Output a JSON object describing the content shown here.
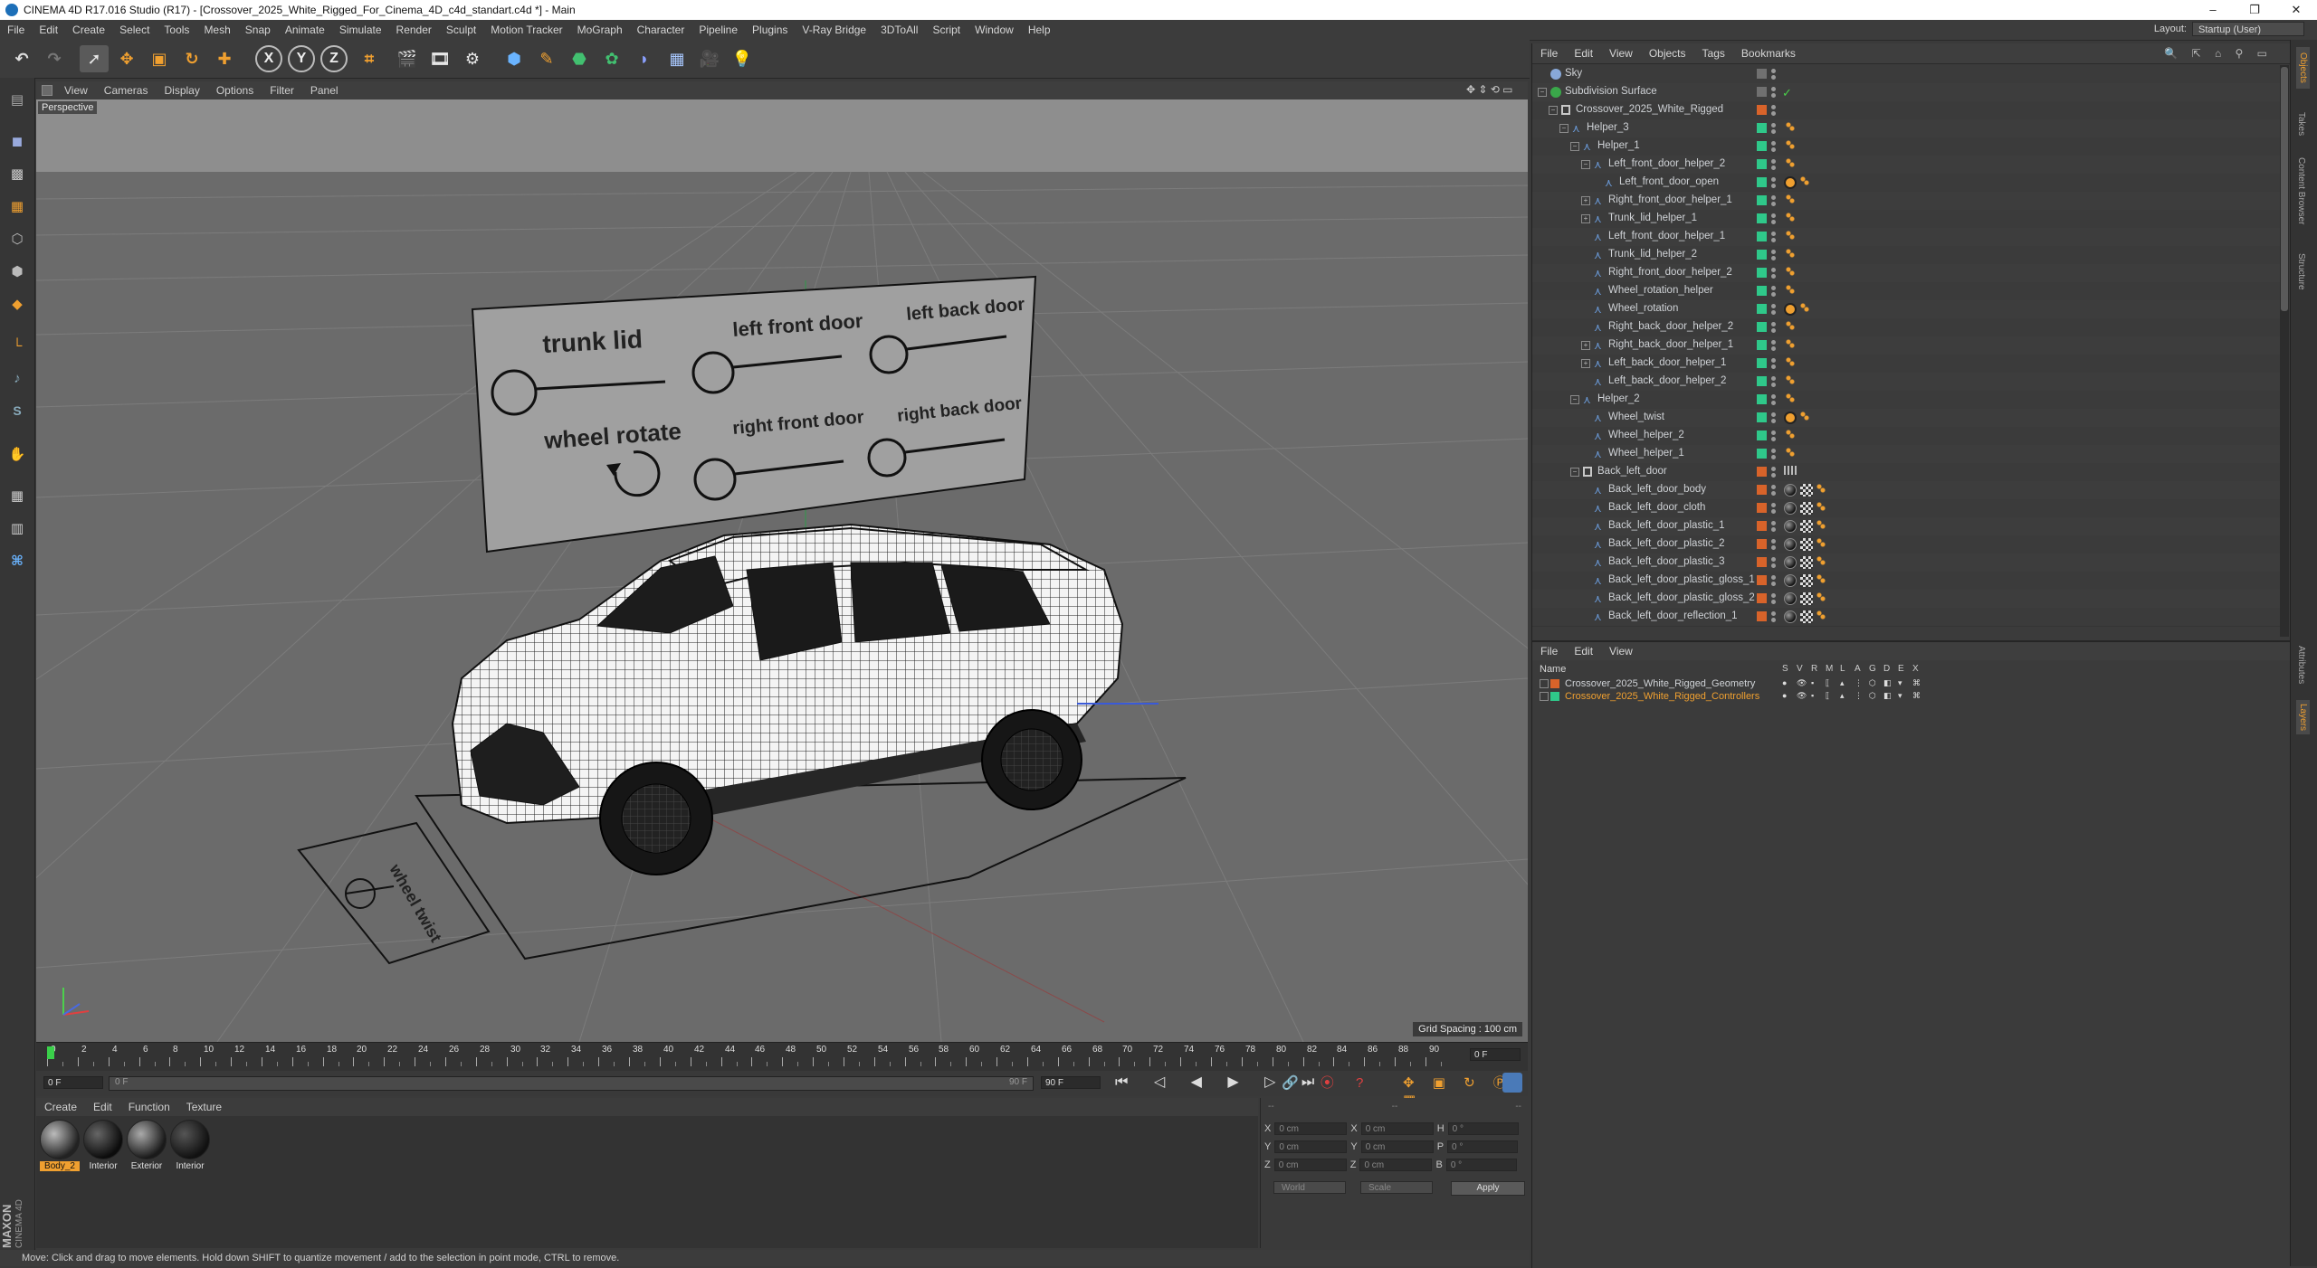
{
  "window": {
    "title": "CINEMA 4D R17.016 Studio (R17) - [Crossover_2025_White_Rigged_For_Cinema_4D_c4d_standart.c4d *] - Main",
    "min": "–",
    "max": "❐",
    "close": "✕"
  },
  "menubar": [
    "File",
    "Edit",
    "Create",
    "Select",
    "Tools",
    "Mesh",
    "Snap",
    "Animate",
    "Simulate",
    "Render",
    "Sculpt",
    "Motion Tracker",
    "MoGraph",
    "Character",
    "Pipeline",
    "Plugins",
    "V-Ray Bridge",
    "3DToAll",
    "Script",
    "Window",
    "Help"
  ],
  "layout": {
    "label": "Layout:",
    "value": "Startup (User)"
  },
  "toolbar_icons": [
    "undo-icon",
    "redo-icon",
    "live-selection-icon",
    "move-icon",
    "scale-icon",
    "rotate-icon",
    "add-icon",
    "x-axis-icon",
    "y-axis-icon",
    "z-axis-icon",
    "coordinate-system-icon",
    "render-view-icon",
    "render-picture-viewer-icon",
    "edit-render-settings-icon",
    "cube-icon",
    "pen-icon",
    "subdivision-icon",
    "cloner-icon",
    "deformer-icon",
    "floor-icon",
    "camera-icon",
    "light-icon"
  ],
  "toolbar_axis": {
    "x": "X",
    "y": "Y",
    "z": "Z"
  },
  "left_tool_labels": {
    "s": "S"
  },
  "viewport": {
    "menu": [
      "View",
      "Cameras",
      "Display",
      "Options",
      "Filter",
      "Panel"
    ],
    "projection": "Perspective",
    "grid_spacing": "Grid Spacing : 100 cm",
    "board_labels": [
      "trunk lid",
      "left front door",
      "left back door",
      "wheel rotate",
      "right front door",
      "right back door"
    ],
    "small_board_label": "wheel twist"
  },
  "timeline": {
    "ticks": [
      "0",
      "2",
      "4",
      "6",
      "8",
      "10",
      "12",
      "14",
      "16",
      "18",
      "20",
      "22",
      "24",
      "26",
      "28",
      "30",
      "32",
      "34",
      "36",
      "38",
      "40",
      "42",
      "44",
      "46",
      "48",
      "50",
      "52",
      "54",
      "56",
      "58",
      "60",
      "62",
      "64",
      "66",
      "68",
      "70",
      "72",
      "74",
      "76",
      "78",
      "80",
      "82",
      "84",
      "86",
      "88",
      "90"
    ],
    "current_frame": "0 F",
    "start_field": "0 F",
    "end_field": "90 F",
    "slider_left": "0 F",
    "slider_right": "90 F"
  },
  "materials": {
    "menu": [
      "Create",
      "Edit",
      "Function",
      "Texture"
    ],
    "items": [
      {
        "name": "Body_2",
        "selected": true
      },
      {
        "name": "Interior",
        "selected": false
      },
      {
        "name": "Exterior",
        "selected": false
      },
      {
        "name": "Interior",
        "selected": false
      }
    ]
  },
  "coords": {
    "header_dashes": [
      "--",
      "--",
      "--"
    ],
    "rows": [
      {
        "a": "X",
        "av": "0 cm",
        "b": "X",
        "bv": "0 cm",
        "c": "H",
        "cv": "0 °"
      },
      {
        "a": "Y",
        "av": "0 cm",
        "b": "Y",
        "bv": "0 cm",
        "c": "P",
        "cv": "0 °"
      },
      {
        "a": "Z",
        "av": "0 cm",
        "b": "Z",
        "bv": "0 cm",
        "c": "B",
        "cv": "0 °"
      }
    ],
    "mode1": "World",
    "mode2": "Scale",
    "apply": "Apply"
  },
  "status": "Move: Click and drag to move elements. Hold down SHIFT to quantize movement / add to the selection in point mode, CTRL to remove.",
  "maxon": {
    "brand": "MAXON",
    "product": "CINEMA 4D"
  },
  "objects": {
    "menu": [
      "File",
      "Edit",
      "View",
      "Objects",
      "Tags",
      "Bookmarks"
    ],
    "rows": [
      {
        "name": "Sky",
        "indent": 0,
        "icon": "sky",
        "color": "#707070",
        "tags": "none",
        "exp": ""
      },
      {
        "name": "Subdivision Surface",
        "indent": 0,
        "icon": "subdiv",
        "color": "#707070",
        "tags": "check",
        "exp": "-"
      },
      {
        "name": "Crossover_2025_White_Rigged",
        "indent": 1,
        "icon": "null",
        "color": "#d8632a",
        "tags": "none",
        "exp": "-"
      },
      {
        "name": "Helper_3",
        "indent": 2,
        "icon": "joint",
        "color": "#2fc88a",
        "tags": "dot",
        "exp": "-"
      },
      {
        "name": "Helper_1",
        "indent": 3,
        "icon": "joint",
        "color": "#2fc88a",
        "tags": "dot",
        "exp": "-"
      },
      {
        "name": "Left_front_door_helper_2",
        "indent": 4,
        "icon": "joint",
        "color": "#2fc88a",
        "tags": "dot",
        "exp": "-"
      },
      {
        "name": "Left_front_door_open",
        "indent": 5,
        "icon": "joint",
        "color": "#2fc88a",
        "tags": "xp",
        "exp": ""
      },
      {
        "name": "Right_front_door_helper_1",
        "indent": 4,
        "icon": "joint",
        "color": "#2fc88a",
        "tags": "dot",
        "exp": "+"
      },
      {
        "name": "Trunk_lid_helper_1",
        "indent": 4,
        "icon": "joint",
        "color": "#2fc88a",
        "tags": "dot",
        "exp": "+"
      },
      {
        "name": "Left_front_door_helper_1",
        "indent": 4,
        "icon": "joint",
        "color": "#2fc88a",
        "tags": "dot",
        "exp": ""
      },
      {
        "name": "Trunk_lid_helper_2",
        "indent": 4,
        "icon": "joint",
        "color": "#2fc88a",
        "tags": "dot",
        "exp": ""
      },
      {
        "name": "Right_front_door_helper_2",
        "indent": 4,
        "icon": "joint",
        "color": "#2fc88a",
        "tags": "dot",
        "exp": ""
      },
      {
        "name": "Wheel_rotation_helper",
        "indent": 4,
        "icon": "joint",
        "color": "#2fc88a",
        "tags": "dot",
        "exp": ""
      },
      {
        "name": "Wheel_rotation",
        "indent": 4,
        "icon": "joint",
        "color": "#2fc88a",
        "tags": "xp",
        "exp": ""
      },
      {
        "name": "Right_back_door_helper_2",
        "indent": 4,
        "icon": "joint",
        "color": "#2fc88a",
        "tags": "dot",
        "exp": ""
      },
      {
        "name": "Right_back_door_helper_1",
        "indent": 4,
        "icon": "joint",
        "color": "#2fc88a",
        "tags": "dot",
        "exp": "+"
      },
      {
        "name": "Left_back_door_helper_1",
        "indent": 4,
        "icon": "joint",
        "color": "#2fc88a",
        "tags": "dot",
        "exp": "+"
      },
      {
        "name": "Left_back_door_helper_2",
        "indent": 4,
        "icon": "joint",
        "color": "#2fc88a",
        "tags": "dot",
        "exp": ""
      },
      {
        "name": "Helper_2",
        "indent": 3,
        "icon": "joint",
        "color": "#2fc88a",
        "tags": "dot",
        "exp": "-"
      },
      {
        "name": "Wheel_twist",
        "indent": 4,
        "icon": "joint",
        "color": "#2fc88a",
        "tags": "xp",
        "exp": ""
      },
      {
        "name": "Wheel_helper_2",
        "indent": 4,
        "icon": "joint",
        "color": "#2fc88a",
        "tags": "dot",
        "exp": ""
      },
      {
        "name": "Wheel_helper_1",
        "indent": 4,
        "icon": "joint",
        "color": "#2fc88a",
        "tags": "dot",
        "exp": ""
      },
      {
        "name": "Back_left_door",
        "indent": 3,
        "icon": "null",
        "color": "#d8632a",
        "tags": "grid",
        "exp": "-"
      },
      {
        "name": "Back_left_door_body",
        "indent": 4,
        "icon": "joint",
        "color": "#d8632a",
        "tags": "mat",
        "exp": ""
      },
      {
        "name": "Back_left_door_cloth",
        "indent": 4,
        "icon": "joint",
        "color": "#d8632a",
        "tags": "mat",
        "exp": ""
      },
      {
        "name": "Back_left_door_plastic_1",
        "indent": 4,
        "icon": "joint",
        "color": "#d8632a",
        "tags": "mat",
        "exp": ""
      },
      {
        "name": "Back_left_door_plastic_2",
        "indent": 4,
        "icon": "joint",
        "color": "#d8632a",
        "tags": "mat",
        "exp": ""
      },
      {
        "name": "Back_left_door_plastic_3",
        "indent": 4,
        "icon": "joint",
        "color": "#d8632a",
        "tags": "mat",
        "exp": ""
      },
      {
        "name": "Back_left_door_plastic_gloss_1",
        "indent": 4,
        "icon": "joint",
        "color": "#d8632a",
        "tags": "mat",
        "exp": ""
      },
      {
        "name": "Back_left_door_plastic_gloss_2",
        "indent": 4,
        "icon": "joint",
        "color": "#d8632a",
        "tags": "mat",
        "exp": ""
      },
      {
        "name": "Back_left_door_reflection_1",
        "indent": 4,
        "icon": "joint",
        "color": "#d8632a",
        "tags": "mat",
        "exp": ""
      }
    ]
  },
  "layers": {
    "menu": [
      "File",
      "Edit",
      "View"
    ],
    "name_header": "Name",
    "cols": [
      "S",
      "V",
      "R",
      "M",
      "L",
      "A",
      "G",
      "D",
      "E",
      "X"
    ],
    "rows": [
      {
        "name": "Crossover_2025_White_Rigged_Geometry",
        "color": "#d8632a",
        "text_color": "#cfd2d6"
      },
      {
        "name": "Crossover_2025_White_Rigged_Controllers",
        "color": "#2fc88a",
        "text_color": "#f0a030"
      }
    ]
  },
  "right_tabs": [
    "Objects",
    "Takes",
    "Content Browser",
    "Structure",
    "Attributes",
    "Layers"
  ]
}
